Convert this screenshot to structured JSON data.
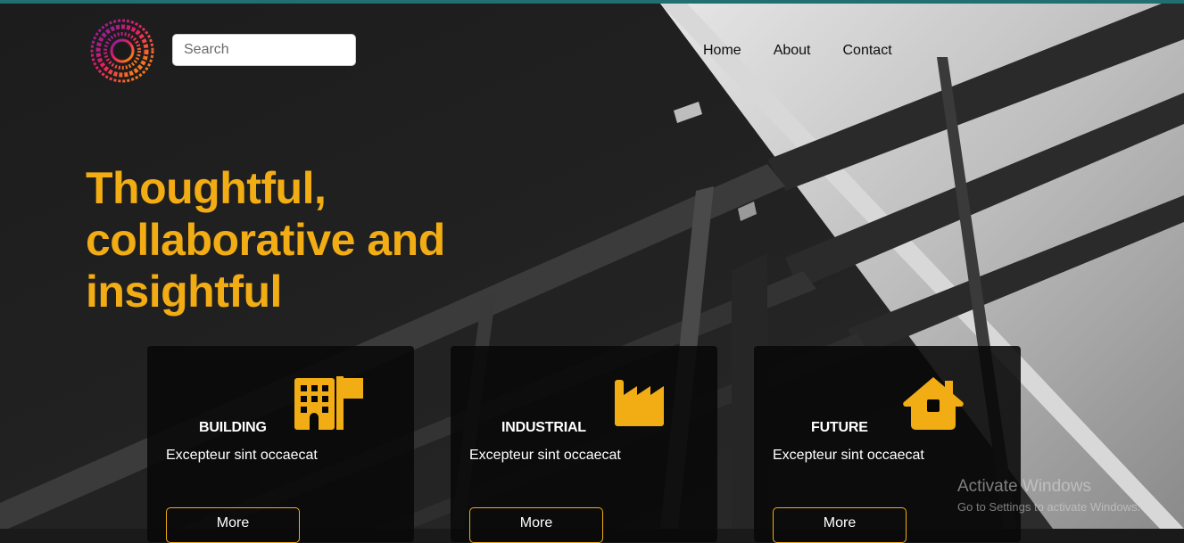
{
  "colors": {
    "accent": "#f2ac14",
    "topbar": "#1f6f73"
  },
  "header": {
    "search_placeholder": "Search",
    "nav": [
      "Home",
      "About",
      "Contact"
    ]
  },
  "hero": {
    "headline_lines": [
      "Thoughtful,",
      "collaborative and",
      "insightful"
    ]
  },
  "cards": [
    {
      "title": "BUILDING",
      "description": "Excepteur sint occaecat",
      "button": "More",
      "icon": "building-icon"
    },
    {
      "title": "INDUSTRIAL",
      "description": "Excepteur sint occaecat",
      "button": "More",
      "icon": "factory-icon"
    },
    {
      "title": "FUTURE",
      "description": "Excepteur sint occaecat",
      "button": "More",
      "icon": "home-icon"
    }
  ],
  "watermark": {
    "line1": "Activate Windows",
    "line2": "Go to Settings to activate Windows."
  }
}
